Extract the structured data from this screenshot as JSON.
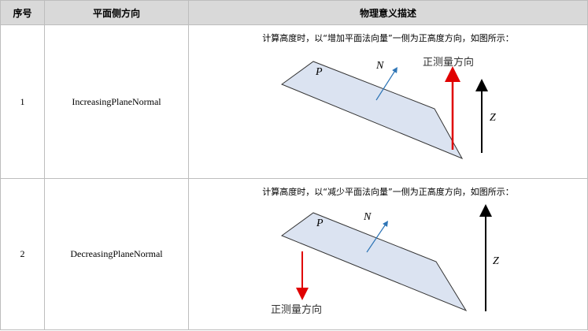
{
  "table": {
    "headers": {
      "index": "序号",
      "direction": "平面侧方向",
      "meaning": "物理意义描述"
    },
    "rows": [
      {
        "index": "1",
        "direction": "IncreasingPlaneNormal",
        "description": "计算高度时，以“增加平面法向量”一侧为正高度方向，如图所示：",
        "diagram": {
          "plane_label": "P",
          "normal_label": "N",
          "axis_label": "Z",
          "measure_label": "正测量方向",
          "measure_arrow": "up",
          "measure_color": "#e00000",
          "normal_color": "#2e75b6",
          "plane_fill": "#dbe3f1"
        }
      },
      {
        "index": "2",
        "direction": "DecreasingPlaneNormal",
        "description": "计算高度时，以“减少平面法向量”一侧为正高度方向，如图所示：",
        "diagram": {
          "plane_label": "P",
          "normal_label": "N",
          "axis_label": "Z",
          "measure_label": "正测量方向",
          "measure_arrow": "down",
          "measure_color": "#e00000",
          "normal_color": "#2e75b6",
          "plane_fill": "#dbe3f1"
        }
      }
    ]
  }
}
